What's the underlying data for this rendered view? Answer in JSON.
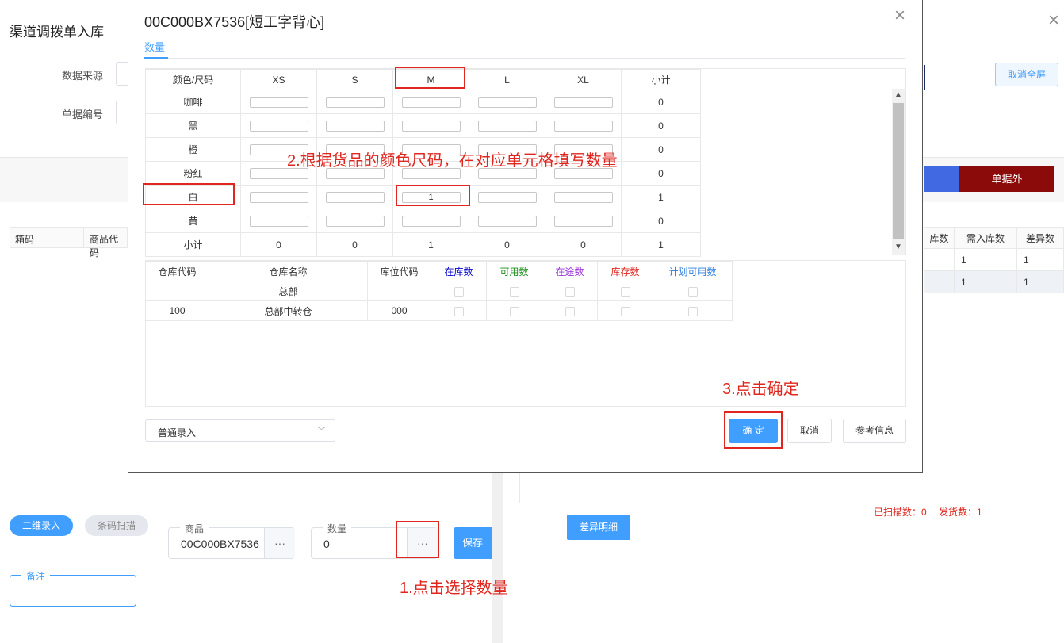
{
  "page": {
    "title": "渠道调拨单入库",
    "labels": {
      "data_source": "数据来源",
      "doc_no": "单据编号"
    },
    "cancel_fullscreen": "取消全屏",
    "close": "×",
    "doc_outside_tab": "单据外",
    "left_table_headers": [
      "箱码",
      "商品代码"
    ],
    "right_table_headers": [
      "库数",
      "需入库数",
      "差异数"
    ],
    "right_table_rows": [
      [
        "",
        "1",
        "1"
      ],
      [
        "",
        "1",
        "1"
      ]
    ],
    "qr_entry": "二维录入",
    "barcode_scan": "条码扫描",
    "product_label": "商品",
    "product_value": "00C000BX7536",
    "qty_label": "数量",
    "qty_value": "0",
    "dots": "···",
    "save": "保存",
    "remark_label": "备注",
    "diff_detail": "差异明细",
    "scan_status": "已扫描数：0　 发货数：1"
  },
  "modal": {
    "title": "00C000BX7536[短工字背心]",
    "tab": "数量",
    "size_table": {
      "corner": "颜色/尺码",
      "sizes": [
        "XS",
        "S",
        "M",
        "L",
        "XL"
      ],
      "subtotal_header": "小计",
      "rows": [
        {
          "color": "咖啡",
          "values": [
            "",
            "",
            "",
            "",
            ""
          ],
          "subtotal": "0"
        },
        {
          "color": "黑",
          "values": [
            "",
            "",
            "",
            "",
            ""
          ],
          "subtotal": "0"
        },
        {
          "color": "橙",
          "values": [
            "",
            "",
            "",
            "",
            ""
          ],
          "subtotal": "0"
        },
        {
          "color": "粉红",
          "values": [
            "",
            "",
            "",
            "",
            ""
          ],
          "subtotal": "0"
        },
        {
          "color": "白",
          "values": [
            "",
            "",
            "1",
            "",
            ""
          ],
          "subtotal": "1"
        },
        {
          "color": "黄",
          "values": [
            "",
            "",
            "",
            "",
            ""
          ],
          "subtotal": "0"
        }
      ],
      "footer": {
        "label": "小计",
        "values": [
          "0",
          "0",
          "1",
          "0",
          "0"
        ],
        "total": "1"
      }
    },
    "warehouse_table": {
      "headers": [
        "仓库代码",
        "仓库名称",
        "库位代码",
        "在库数",
        "可用数",
        "在途数",
        "库存数",
        "计划可用数"
      ],
      "header_colors": [
        "#333333",
        "#333333",
        "#333333",
        "#0000cc",
        "#1a8f1a",
        "#9b30d9",
        "#e0261e",
        "#2a7de1"
      ],
      "rows": [
        {
          "code": "",
          "name": "总部",
          "loc": ""
        },
        {
          "code": "100",
          "name": "总部中转仓",
          "loc": "000"
        }
      ]
    },
    "entry_mode": "普通录入",
    "ok": "确 定",
    "cancel": "取消",
    "ref_info": "参考信息"
  },
  "annotations": {
    "step1": "1.点击选择数量",
    "step2": "2.根据货品的颜色尺码，在对应单元格填写数量",
    "step3": "3.点击确定"
  },
  "colors": {
    "primary": "#409eff",
    "dark_red": "#8b0a0a",
    "blue_tab": "#4169e1",
    "annotation": "#e0261e"
  }
}
